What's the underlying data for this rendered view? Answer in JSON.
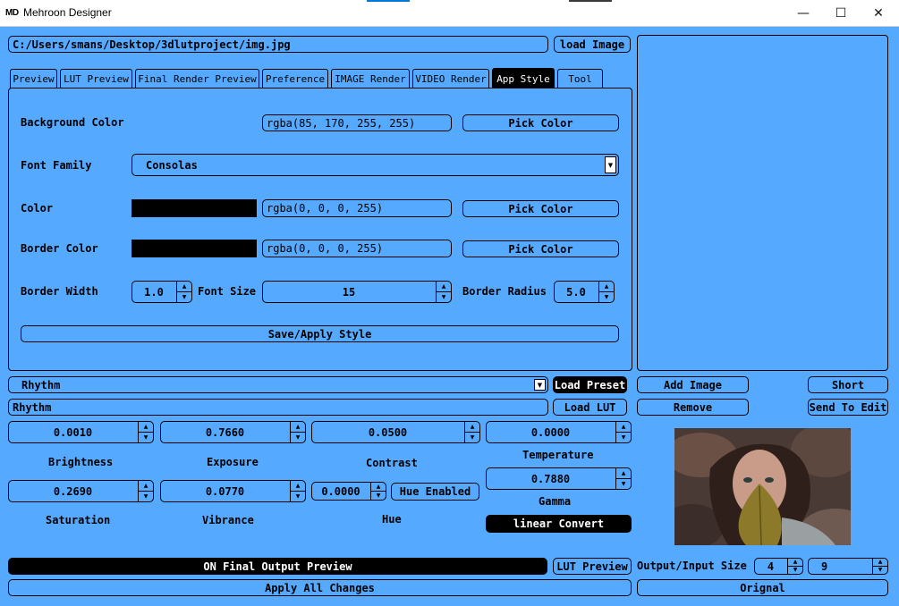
{
  "window": {
    "logo": "MD",
    "title": "Mehroon Designer",
    "minimize_glyph": "—",
    "maximize_glyph": "☐",
    "close_glyph": "✕"
  },
  "top": {
    "path_value": "C:/Users/smans/Desktop/3dlutproject/img.jpg",
    "load_image_label": "load Image"
  },
  "tabs": [
    {
      "label": "Preview"
    },
    {
      "label": "LUT Preview"
    },
    {
      "label": "Final Render Preview"
    },
    {
      "label": "Preference"
    },
    {
      "label": "IMAGE Render"
    },
    {
      "label": "VIDEO Render"
    },
    {
      "label": "App Style",
      "active": true
    },
    {
      "label": "Tool"
    }
  ],
  "app_style": {
    "background_color_label": "Background Color",
    "background_color_value": "rgba(85, 170, 255, 255)",
    "pick_color_label": "Pick Color",
    "font_family_label": "Font Family",
    "font_family_value": "Consolas",
    "color_label": "Color",
    "color_value": "rgba(0, 0, 0, 255)",
    "border_color_label": "Border Color",
    "border_color_value": "rgba(0, 0, 0, 255)",
    "border_width_label": "Border Width",
    "border_width_value": "1.0",
    "font_size_label": "Font Size",
    "font_size_value": "15",
    "border_radius_label": "Border Radius",
    "border_radius_value": "5.0",
    "save_apply_label": "Save/Apply Style"
  },
  "right_panel": {
    "add_image_label": "Add Image",
    "short_label": "Short",
    "remove_label": "Remove",
    "send_to_edit_label": "Send To Edit"
  },
  "preset": {
    "preset_value": "Rhythm",
    "load_preset_label": "Load Preset",
    "lut_value": "Rhythm",
    "load_lut_label": "Load LUT"
  },
  "adjustments": {
    "brightness_value": "0.0010",
    "brightness_label": "Brightness",
    "exposure_value": "0.7660",
    "exposure_label": "Exposure",
    "contrast_value": "0.0500",
    "contrast_label": "Contrast",
    "temperature_value": "0.0000",
    "temperature_label": "Temperature",
    "gamma_value": "0.7880",
    "gamma_label": "Gamma",
    "saturation_value": "0.2690",
    "saturation_label": "Saturation",
    "vibrance_value": "0.0770",
    "vibrance_label": "Vibrance",
    "hue_value": "0.0000",
    "hue_label": "Hue",
    "hue_enabled_label": "Hue Enabled",
    "linear_convert_label": "linear Convert"
  },
  "bottom": {
    "final_output_label": "ON Final Output Preview",
    "lut_preview_label": "LUT Preview",
    "output_input_size_label": "Output/Input Size",
    "output_size_value": "4",
    "input_size_value": "9",
    "apply_all_label": "Apply All Changes",
    "orignal_label": "Orignal"
  },
  "colors": {
    "background": "#55aaff",
    "border": "#000000",
    "active_tab": "#000000"
  }
}
